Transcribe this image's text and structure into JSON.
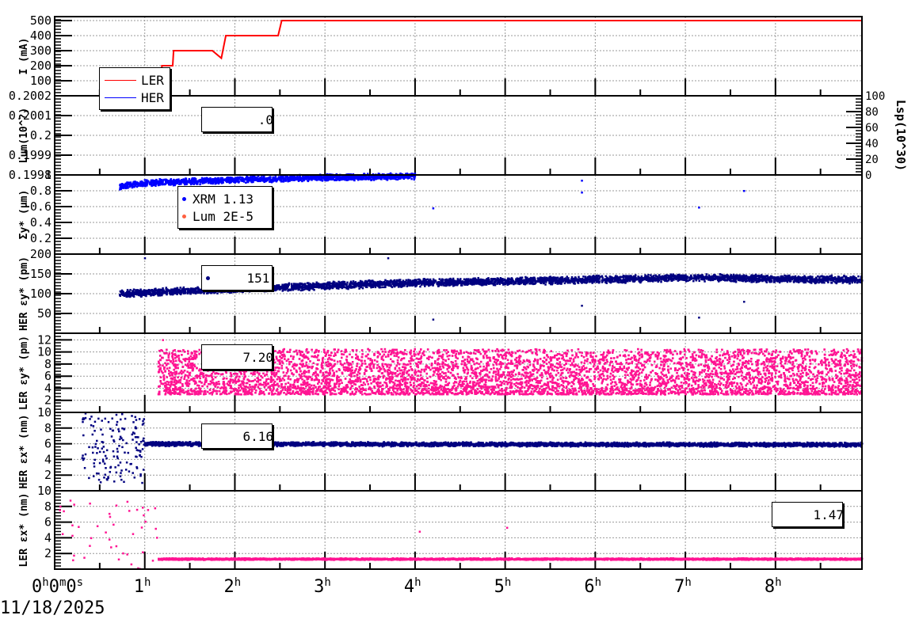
{
  "chart_data": {
    "type": "scatter",
    "x_unit": "hours",
    "xlim": [
      0,
      8.96
    ],
    "x_ticks": [
      {
        "main": "0",
        "parts": [
          [
            "0",
            "h"
          ],
          [
            "0",
            "m"
          ],
          [
            "0",
            "s"
          ]
        ]
      },
      {
        "main": "1h",
        "parts": [
          [
            "1",
            "h"
          ]
        ]
      },
      {
        "main": "2h",
        "parts": [
          [
            "2",
            "h"
          ]
        ]
      },
      {
        "main": "3h",
        "parts": [
          [
            "3",
            "h"
          ]
        ]
      },
      {
        "main": "4h",
        "parts": [
          [
            "4",
            "h"
          ]
        ]
      },
      {
        "main": "5h",
        "parts": [
          [
            "5",
            "h"
          ]
        ]
      },
      {
        "main": "6h",
        "parts": [
          [
            "6",
            "h"
          ]
        ]
      },
      {
        "main": "7h",
        "parts": [
          [
            "7",
            "h"
          ]
        ]
      },
      {
        "main": "8h",
        "parts": [
          [
            "8",
            "h"
          ]
        ]
      }
    ],
    "x_tick_hours": [
      0,
      1,
      2,
      3,
      4,
      5,
      6,
      7,
      8
    ],
    "date": "11/18/2025",
    "grid": true,
    "panels": [
      {
        "ylabel": "I (mA)",
        "ylim": [
          0,
          526
        ],
        "ticks": [
          "100",
          "200",
          "300",
          "400",
          "500"
        ],
        "tick_values": [
          100,
          200,
          300,
          400,
          500
        ],
        "series": [
          {
            "name": "LER",
            "color": "#ff0000",
            "kind": "line",
            "points": [
              [
                1.18,
                0
              ],
              [
                1.19,
                200
              ],
              [
                1.31,
                200
              ],
              [
                1.32,
                300
              ],
              [
                1.75,
                300
              ],
              [
                1.85,
                250
              ],
              [
                1.9,
                400
              ],
              [
                2.48,
                400
              ],
              [
                2.52,
                500
              ],
              [
                8.96,
                500
              ]
            ]
          },
          {
            "name": "HER",
            "color": "#0000ff",
            "kind": "line",
            "points": [
              [
                0,
                0
              ],
              [
                8.96,
                0
              ]
            ]
          }
        ],
        "legend": [
          {
            "label": "LER",
            "color": "#ff0000",
            "style": "line"
          },
          {
            "label": "HER",
            "color": "#0000ff",
            "style": "line"
          }
        ]
      },
      {
        "ylabel": "Lum(10^?)",
        "ylim": [
          0.1998,
          0.2002
        ],
        "ticks": [
          "0.1998",
          "0.1999",
          "0.2",
          "0.2001",
          "0.2002"
        ],
        "tick_values": [
          0.1998,
          0.1999,
          0.2,
          0.2001,
          0.2002
        ],
        "right_axis": {
          "label": "Lsp(10^30)",
          "ticks": [
            "0",
            "20",
            "40",
            "60",
            "80",
            "100"
          ],
          "tick_values": [
            0,
            20,
            40,
            60,
            80,
            100
          ],
          "ylim": [
            0,
            100
          ]
        },
        "series": [
          {
            "name": "Lum",
            "color": "#0000ff",
            "kind": "line",
            "points": [
              [
                0,
                0.2002
              ],
              [
                8.96,
                0.2002
              ]
            ]
          },
          {
            "name": "Lsp",
            "color": "#3a7a2a",
            "kind": "line",
            "points": [
              [
                0,
                0.1998
              ],
              [
                8.96,
                0.1998
              ]
            ]
          }
        ],
        "legend": [
          {
            "label": "      .0",
            "color": "#e8a000",
            "style": "dot"
          }
        ]
      },
      {
        "ylabel": "Σy* (µm)",
        "ylim": [
          0,
          1.0
        ],
        "ticks": [
          "0.2",
          "0.4",
          "0.6",
          "0.8",
          "1"
        ],
        "tick_values": [
          0.2,
          0.4,
          0.6,
          0.8,
          1.0
        ],
        "series": [
          {
            "name": "XRM",
            "color": "#0000ff",
            "kind": "scatter",
            "start": 0.72,
            "end": 4.0,
            "trend": [
              [
                0.72,
                0.86
              ],
              [
                1.0,
                0.9
              ],
              [
                2.0,
                0.94
              ],
              [
                3.0,
                0.97
              ],
              [
                4.0,
                0.985
              ]
            ],
            "spread": 0.03,
            "outliers": [
              [
                4.2,
                0.58
              ],
              [
                5.85,
                0.93
              ],
              [
                5.85,
                0.78
              ],
              [
                7.15,
                0.59
              ],
              [
                7.65,
                0.8
              ]
            ]
          }
        ],
        "legend": [
          {
            "label": "XRM 1.13",
            "color": "#0000ff",
            "style": "dot"
          },
          {
            "label": "Lum 2E-5",
            "color": "#ff6040",
            "style": "dot"
          }
        ]
      },
      {
        "ylabel": "HER εy* (pm)",
        "ylim": [
          0,
          200
        ],
        "ticks": [
          "50",
          "100",
          "150",
          "200"
        ],
        "tick_values": [
          50,
          100,
          150,
          200
        ],
        "series": [
          {
            "name": "HER εy*",
            "color": "#000080",
            "kind": "scatter",
            "start": 0.72,
            "end": 8.96,
            "trend": [
              [
                0.72,
                100
              ],
              [
                1.0,
                103
              ],
              [
                2.0,
                112
              ],
              [
                3.0,
                120
              ],
              [
                4.0,
                128
              ],
              [
                5.0,
                132
              ],
              [
                6.0,
                136
              ],
              [
                7.0,
                141
              ],
              [
                8.0,
                138
              ],
              [
                8.96,
                135
              ]
            ],
            "spread": 7,
            "outliers": [
              [
                1.0,
                190
              ],
              [
                3.7,
                190
              ],
              [
                4.2,
                35
              ],
              [
                5.85,
                70
              ],
              [
                7.15,
                40
              ],
              [
                7.65,
                80
              ]
            ]
          }
        ],
        "legend": [
          {
            "label": "    151",
            "color": "#000080",
            "style": "dot"
          }
        ]
      },
      {
        "ylabel": "LER εy* (pm)",
        "ylim": [
          0,
          13.1
        ],
        "ticks": [
          "2",
          "4",
          "6",
          "8",
          "10",
          "12"
        ],
        "tick_values": [
          2,
          4,
          6,
          8,
          10,
          12
        ],
        "series": [
          {
            "name": "LER εy*",
            "color": "#ff1493",
            "kind": "scatter",
            "start": 1.15,
            "end": 8.96,
            "trend": [
              [
                1.15,
                5.0
              ],
              [
                8.96,
                6.0
              ]
            ],
            "band": [
              3.0,
              10.5
            ],
            "outliers": [
              [
                1.2,
                12
              ]
            ]
          }
        ],
        "legend": [
          {
            "label": "    7.20",
            "color": "#ff1493",
            "style": "dot"
          }
        ]
      },
      {
        "ylabel": "HER εx* (nm)",
        "ylim": [
          0,
          10
        ],
        "ticks": [
          "2",
          "4",
          "6",
          "8",
          "10"
        ],
        "tick_values": [
          2,
          4,
          6,
          8,
          10
        ],
        "series": [
          {
            "name": "HER εx*",
            "color": "#000080",
            "kind": "scatter",
            "start": 1.0,
            "end": 8.96,
            "trend": [
              [
                1.0,
                6.0
              ],
              [
                8.96,
                5.9
              ]
            ],
            "spread": 0.2,
            "noisy_before": [
              0.3,
              1.0
            ]
          }
        ],
        "legend": [
          {
            "label": "    6.16",
            "color": "#000080",
            "style": "dot"
          }
        ]
      },
      {
        "ylabel": "LER εx* (nm)",
        "ylim": [
          0,
          10
        ],
        "ticks": [
          "2",
          "4",
          "6",
          "8",
          "10"
        ],
        "tick_values": [
          2,
          4,
          6,
          8,
          10
        ],
        "series": [
          {
            "name": "LER εx*",
            "color": "#ff1493",
            "kind": "scatter",
            "start": 1.15,
            "end": 8.96,
            "trend": [
              [
                1.15,
                1.3
              ],
              [
                8.96,
                1.3
              ]
            ],
            "spread": 0.08,
            "noisy_before": [
              0.0,
              1.15
            ],
            "outliers": [
              [
                4.05,
                4.8
              ],
              [
                5.02,
                5.3
              ]
            ]
          }
        ],
        "legend": [
          {
            "label": "    1.47",
            "color": "#ff1493",
            "style": "dot"
          }
        ]
      }
    ]
  }
}
